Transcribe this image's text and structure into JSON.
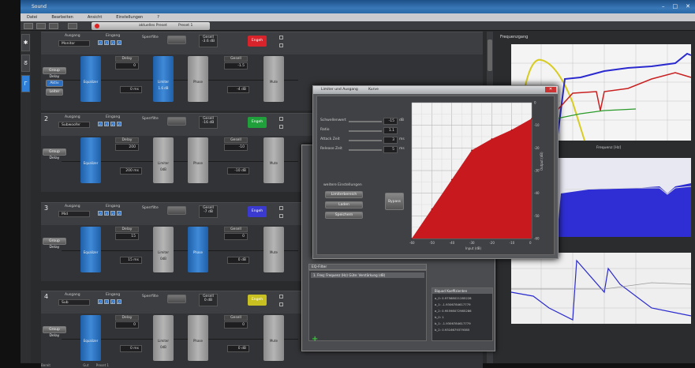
{
  "window": {
    "title": "Sound",
    "controls": [
      "–",
      "□",
      "✕"
    ]
  },
  "menu": [
    "Datei",
    "Bearbeiten",
    "Ansicht",
    "Einstellungen",
    "?"
  ],
  "toolbar": {
    "preset_label": "aktuelles Preset",
    "preset_select": "Preset 1"
  },
  "channels": [
    {
      "num": "",
      "ausgang_label": "Ausgang",
      "ausgang_value": "Monitor",
      "eingang_label": "Eingang",
      "sperren_label": "Sperrfilte",
      "gain_label": "Gesell",
      "gain_value": "-3.6 dB",
      "engage_label": "Engeh",
      "engage_color": "#d8232a",
      "strip": {
        "group_delay": "Group Delay",
        "btn_a": "Aktiv",
        "btn_b": "Leiter",
        "eq": "Equalizer",
        "delay_hdr": "Delay",
        "delay_val": "0",
        "delay_unit": "ms",
        "delay_field": "0 ms",
        "limiter": "Limiter",
        "limiter_val": "1.6 dB",
        "phase": "Phase",
        "gain_hdr": "Gesell",
        "gain_val": "-1.5",
        "gain_field": "-4 dB",
        "mute": "Mute"
      }
    },
    {
      "num": "2",
      "ausgang_label": "Ausgang",
      "ausgang_value": "Subwoofer",
      "eingang_label": "Eingang",
      "sperren_label": "Sperrfilte",
      "gain_label": "Gesell",
      "gain_value": "-16 dB",
      "engage_label": "Engeh",
      "engage_color": "#1fa03a",
      "strip": {
        "group_delay": "Group Delay",
        "eq": "Equalizer",
        "delay_hdr": "Delay",
        "delay_val": "200",
        "delay_unit": "ms",
        "delay_field": "200 ms",
        "limiter": "Limiter",
        "limiter_val": "0dB",
        "phase": "Phase",
        "gain_hdr": "Gesell",
        "gain_val": "-10",
        "gain_field": "-10 dB",
        "mute": "Mute"
      }
    },
    {
      "num": "3",
      "ausgang_label": "Ausgang",
      "ausgang_value": "Mid",
      "eingang_label": "Eingang",
      "sperren_label": "Sperrfilte",
      "gain_label": "Gesell",
      "gain_value": "-7 dB",
      "engage_label": "Engeh",
      "engage_color": "#3a3ad0",
      "strip": {
        "group_delay": "Group Delay",
        "eq": "Equalizer",
        "delay_hdr": "Delay",
        "delay_val": "15",
        "delay_unit": "ms",
        "delay_field": "15 ms",
        "limiter": "Limiter",
        "limiter_val": "0dB",
        "phase": "Phase",
        "gain_hdr": "Gesell",
        "gain_val": "0",
        "gain_field": "0 dB",
        "mute": "Mute"
      }
    },
    {
      "num": "4",
      "ausgang_label": "Ausgang",
      "ausgang_value": "Sub",
      "eingang_label": "Eingang",
      "sperren_label": "Sperrfilte",
      "gain_label": "Gesell",
      "gain_value": "0 dB",
      "engage_label": "Engeh",
      "engage_color": "#c8c020",
      "strip": {
        "group_delay": "Group Delay",
        "eq": "Equalizer",
        "delay_hdr": "Delay",
        "delay_val": "0",
        "delay_unit": "ms",
        "delay_field": "0 ms",
        "limiter": "Limiter",
        "limiter_val": "0dB",
        "phase": "Phase",
        "gain_hdr": "Gesell",
        "gain_val": "0",
        "gain_field": "0 dB",
        "mute": "Mute"
      }
    }
  ],
  "sidetabs": [
    "✱",
    "ᘔ",
    "Γ"
  ],
  "freq_graph": {
    "title": "Frequenzgang",
    "xlabel": "Frequenz [Hz]"
  },
  "dialog": {
    "title": "Limiter und Ausgang",
    "tab": "Kurve",
    "close": "✕",
    "fields": [
      {
        "label": "Schwellenwert",
        "val": "-15",
        "unit": "dB"
      },
      {
        "label": "Ratio",
        "val": "1.1",
        "unit": ""
      },
      {
        "label": "Attack Zeit",
        "val": "3",
        "unit": "ms"
      },
      {
        "label": "Release Zeit",
        "val": "5",
        "unit": "ms"
      }
    ],
    "section": "weitere Einstellungen",
    "btns": [
      "Limiterbereich",
      "Laden",
      "Speichern"
    ],
    "apply": "Bypass",
    "x_axis_label": "Input (dB)",
    "y_axis_label": "Output (dB)"
  },
  "eq_panel": {
    "header": "EQ-Filter",
    "row": "1. Freq: Frequenz (Hz) Güte: Verstärkung (dB)",
    "coef_header": "Biquad Koeffizienten",
    "coefs": [
      "a_0: 0.97568021285228",
      "a_1: -1.9306784617779",
      "a_2: 0.95598072985286",
      "b_0: 1",
      "b_1: -1.9306784617779",
      "b_2: 0.9316679379385"
    ],
    "phase_label": "Phase"
  },
  "status": {
    "text": "Bereit",
    "zoom": "Gut",
    "preset": "Preset 1"
  },
  "chart_data": [
    {
      "type": "area",
      "title": "",
      "xlabel": "Input (dB)",
      "ylabel": "Output (dB)",
      "x": [
        -60,
        -50,
        -40,
        -30,
        -20,
        -10,
        0
      ],
      "y": [
        -60,
        -47,
        -34,
        -21,
        -16,
        -12,
        -7
      ],
      "xlim": [
        -60,
        0
      ],
      "ylim": [
        -60,
        0
      ],
      "grid": true,
      "color": "#c8191f"
    }
  ]
}
